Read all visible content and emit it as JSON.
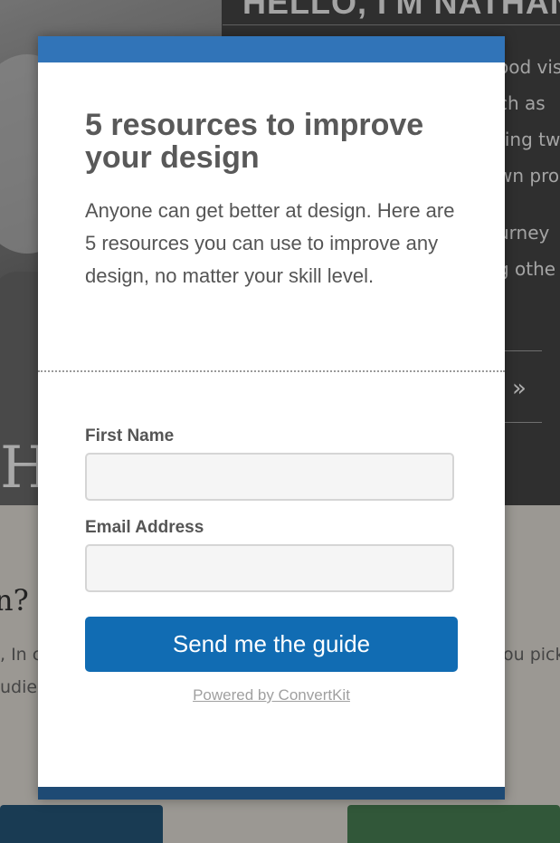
{
  "background": {
    "hero_title": "HELLO, I'M NATHAN.",
    "hero_lines": [
      "ood vis",
      "ch as",
      "ting tw",
      "wn pro",
      "urney",
      "g othe"
    ],
    "chevron": "»",
    "photo_letter": "H",
    "section_heading_fragment": "n?",
    "text_fragments": [
      ", In c",
      "udie",
      "ou pick"
    ]
  },
  "modal": {
    "title": "5 resources to improve your design",
    "description": "Anyone can get better at design. Here are 5 resources you can use to improve any design, no matter your skill level.",
    "first_name_label": "First Name",
    "first_name_value": "",
    "email_label": "Email Address",
    "email_value": "",
    "submit_label": "Send me the guide",
    "powered_by": "Powered by ConvertKit",
    "colors": {
      "top_bar": "#3174b8",
      "bottom_bar": "#1e4a74",
      "button": "#116cb3"
    }
  }
}
